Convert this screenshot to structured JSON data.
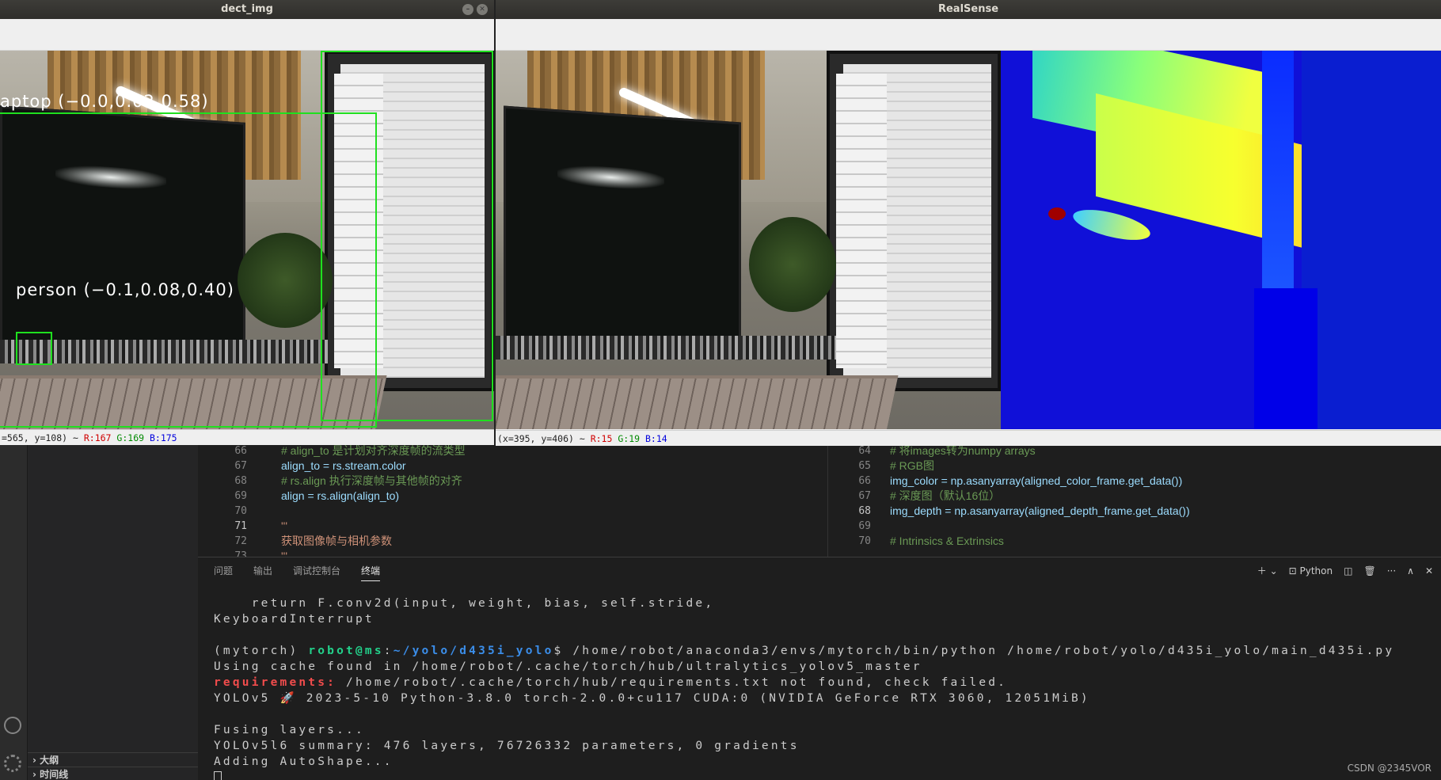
{
  "windows": {
    "dect": {
      "title": "dect_img",
      "status": {
        "coords": "=565, y=108) ~ ",
        "r": "R:167",
        "g": "G:169",
        "b": "B:175"
      },
      "detections": [
        {
          "label": "aptop (−0.0,0.02,0.58)"
        },
        {
          "label": "person (−0.1,0.08,0.40)"
        }
      ]
    },
    "realsense": {
      "title": "RealSense",
      "status": {
        "coords": "(x=395, y=406) ~ ",
        "r": "R:15",
        "g": "G:19",
        "b": "B:14"
      }
    }
  },
  "editor_left": {
    "lines": [
      {
        "num": "66",
        "text": "# align_to 是计划对齐深度帧的流类型",
        "kind": "comment"
      },
      {
        "num": "67",
        "text": "align_to = rs.stream.color",
        "kind": "code"
      },
      {
        "num": "68",
        "text": "# rs.align 执行深度帧与其他帧的对齐",
        "kind": "comment"
      },
      {
        "num": "69",
        "text": "align = rs.align(align_to)",
        "kind": "code"
      },
      {
        "num": "70",
        "text": "",
        "kind": "code"
      },
      {
        "num": "71",
        "text": "'''",
        "kind": "string"
      },
      {
        "num": "72",
        "text": "获取图像帧与相机参数",
        "kind": "string"
      },
      {
        "num": "73",
        "text": "'''",
        "kind": "string"
      }
    ]
  },
  "editor_right": {
    "lines": [
      {
        "num": "64",
        "text": "# 将images转为numpy arrays",
        "kind": "comment"
      },
      {
        "num": "65",
        "text": "# RGB图",
        "kind": "comment"
      },
      {
        "num": "66",
        "text": "img_color = np.asanyarray(aligned_color_frame.get_data())",
        "kind": "code"
      },
      {
        "num": "67",
        "text": "# 深度图（默认16位）",
        "kind": "comment"
      },
      {
        "num": "68",
        "text": "img_depth = np.asanyarray(aligned_depth_frame.get_data())",
        "kind": "code"
      },
      {
        "num": "69",
        "text": "",
        "kind": "code"
      },
      {
        "num": "70",
        "text": "# Intrinsics & Extrinsics",
        "kind": "comment"
      }
    ]
  },
  "panel": {
    "tabs": [
      "问题",
      "输出",
      "调试控制台",
      "终端"
    ],
    "active_tab": "终端",
    "shell_label": "Python",
    "terminal": {
      "line1": "    return F.conv2d(input, weight, bias, self.stride,",
      "line2": "KeyboardInterrupt",
      "prompt_env": "(mytorch) ",
      "prompt_user": "robot@ms",
      "prompt_sep": ":",
      "prompt_path": "~/yolo/d435i_yolo",
      "prompt_cmd": "$ /home/robot/anaconda3/envs/mytorch/bin/python /home/robot/yolo/d435i_yolo/main_d435i.py",
      "line4": "Using cache found in /home/robot/.cache/torch/hub/ultralytics_yolov5_master",
      "req_label": "requirements:",
      "req_rest": " /home/robot/.cache/torch/hub/requirements.txt not found, check failed.",
      "line6": "YOLOv5 🚀 2023-5-10 Python-3.8.0 torch-2.0.0+cu117 CUDA:0 (NVIDIA GeForce RTX 3060, 12051MiB)",
      "line8": "Fusing layers...",
      "line9": "YOLOv5l6 summary: 476 layers, 76726332 parameters, 0 gradients",
      "line10": "Adding AutoShape..."
    }
  },
  "sidebar": {
    "outline": "大纲",
    "timeline": "时间线"
  },
  "watermark": "CSDN @2345VOR"
}
